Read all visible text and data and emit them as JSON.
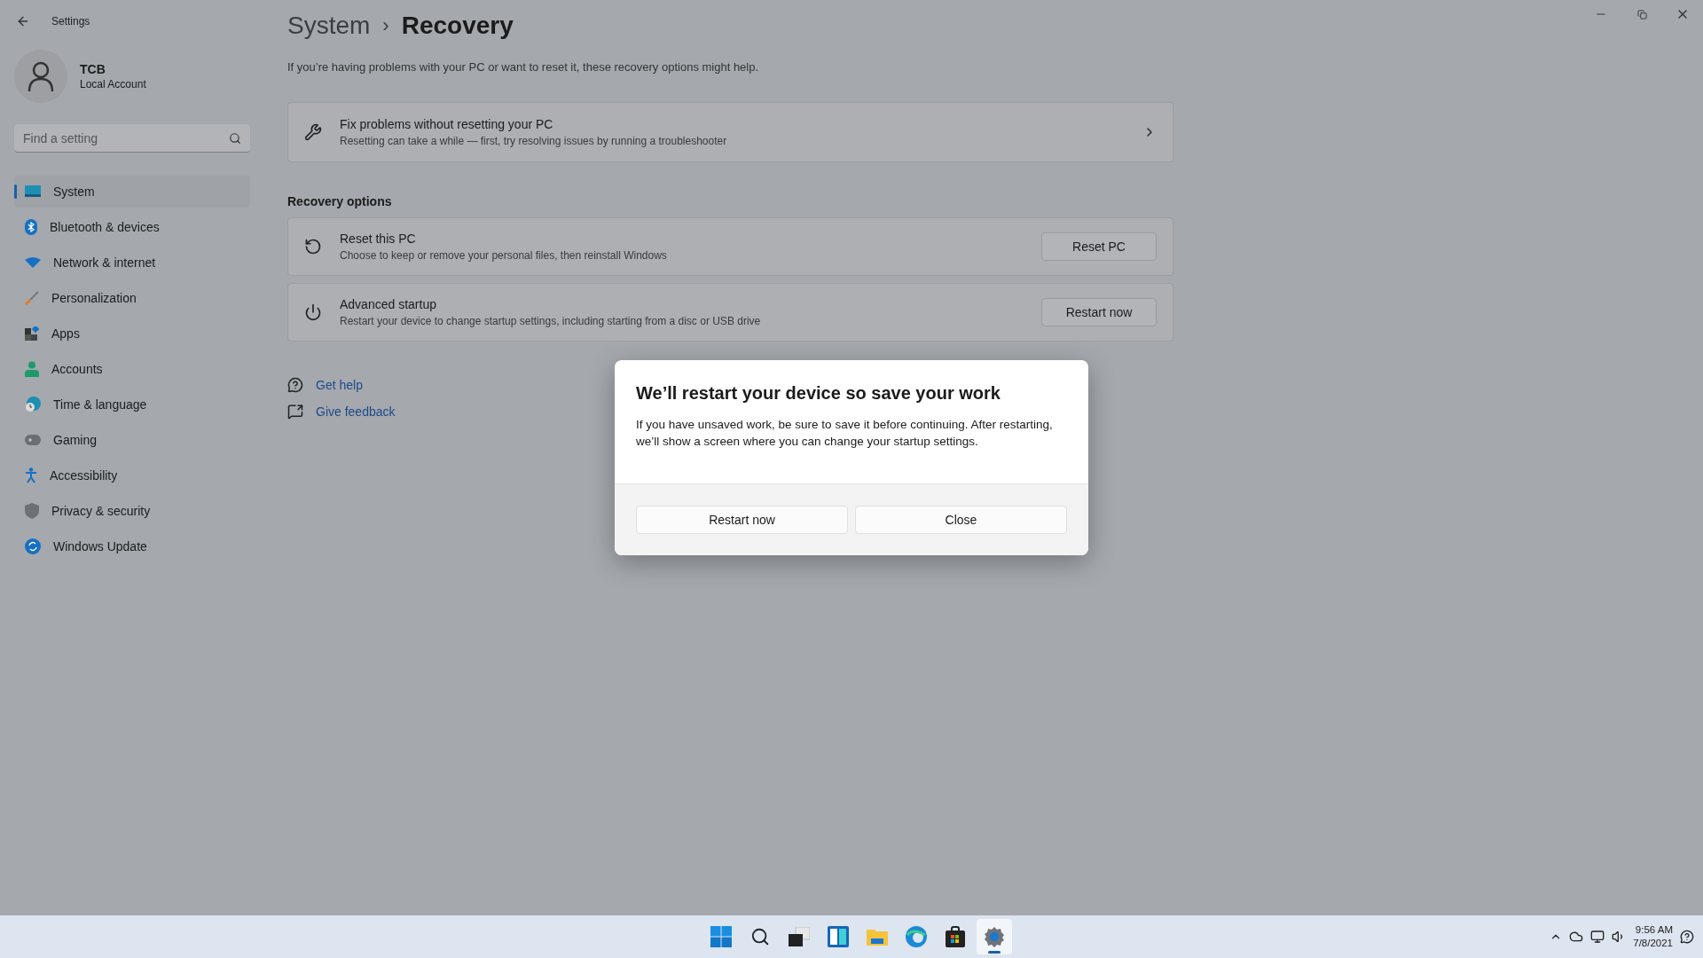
{
  "window": {
    "title": "Settings"
  },
  "account": {
    "name": "TCB",
    "type": "Local Account"
  },
  "search": {
    "placeholder": "Find a setting"
  },
  "sidebar": {
    "items": [
      {
        "label": "System",
        "selected": true
      },
      {
        "label": "Bluetooth & devices",
        "selected": false
      },
      {
        "label": "Network & internet",
        "selected": false
      },
      {
        "label": "Personalization",
        "selected": false
      },
      {
        "label": "Apps",
        "selected": false
      },
      {
        "label": "Accounts",
        "selected": false
      },
      {
        "label": "Time & language",
        "selected": false
      },
      {
        "label": "Gaming",
        "selected": false
      },
      {
        "label": "Accessibility",
        "selected": false
      },
      {
        "label": "Privacy & security",
        "selected": false
      },
      {
        "label": "Windows Update",
        "selected": false
      }
    ]
  },
  "breadcrumb": {
    "parent": "System",
    "separator": "›",
    "current": "Recovery"
  },
  "description": "If you’re having problems with your PC or want to reset it, these recovery options might help.",
  "troubleshoot_card": {
    "title": "Fix problems without resetting your PC",
    "subtitle": "Resetting can take a while — first, try resolving issues by running a troubleshooter"
  },
  "section_title": "Recovery options",
  "options": [
    {
      "title": "Reset this PC",
      "subtitle": "Choose to keep or remove your personal files, then reinstall Windows",
      "button": "Reset PC"
    },
    {
      "title": "Advanced startup",
      "subtitle": "Restart your device to change startup settings, including starting from a disc or USB drive",
      "button": "Restart now"
    }
  ],
  "links": [
    "Get help",
    "Give feedback"
  ],
  "dialog": {
    "title": "We’ll restart your device so save your work",
    "body": "If you have unsaved work, be sure to save it before continuing. After restarting, we’ll show a screen where you can change your startup settings.",
    "buttons": [
      "Restart now",
      "Close"
    ]
  },
  "taskbar": {
    "apps": [
      {
        "selected": false
      },
      {
        "selected": false
      },
      {
        "selected": false
      },
      {
        "selected": false
      },
      {
        "selected": false
      },
      {
        "selected": false
      },
      {
        "selected": false
      },
      {
        "selected": true
      }
    ],
    "time": "9:56 AM",
    "date": "7/8/2021"
  }
}
